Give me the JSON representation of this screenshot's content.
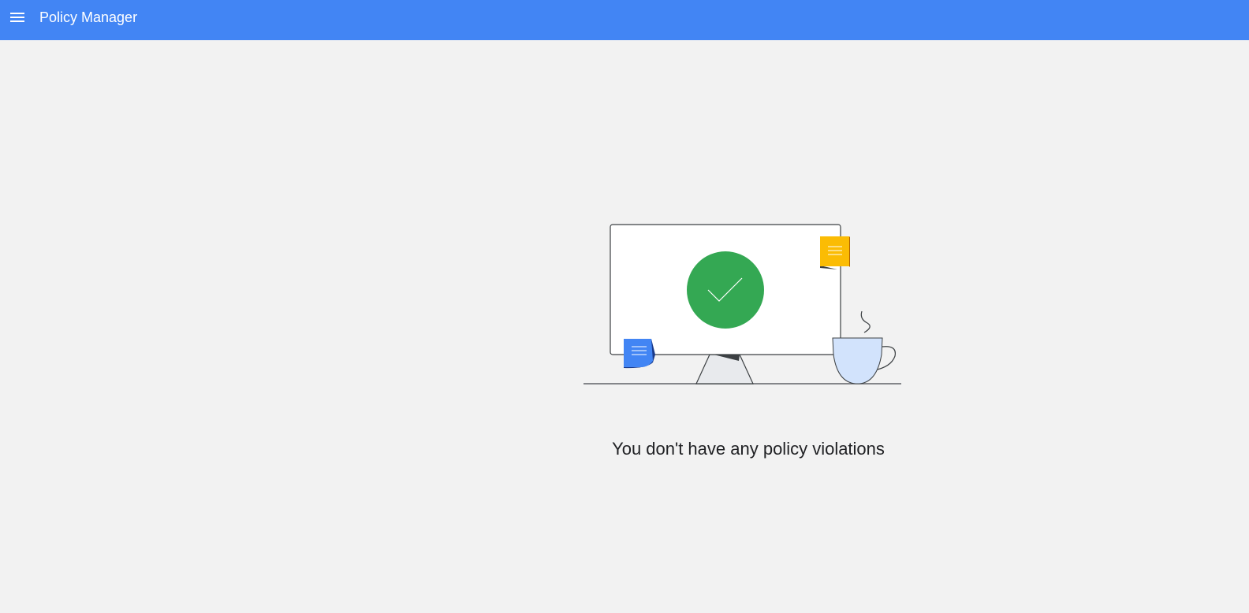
{
  "app_bar": {
    "menu_icon": "menu-icon",
    "title": "Policy Manager",
    "color": "#4285f4"
  },
  "empty_state": {
    "illustration_icons": [
      "monitor-icon",
      "check-circle-icon",
      "sticky-note-icon",
      "coffee-cup-icon"
    ],
    "message": "You don't have any policy violations",
    "check_color": "#34a853",
    "note_yellow": "#fbbc04",
    "note_blue": "#4285f4",
    "cup_color": "#d2e3fc"
  }
}
